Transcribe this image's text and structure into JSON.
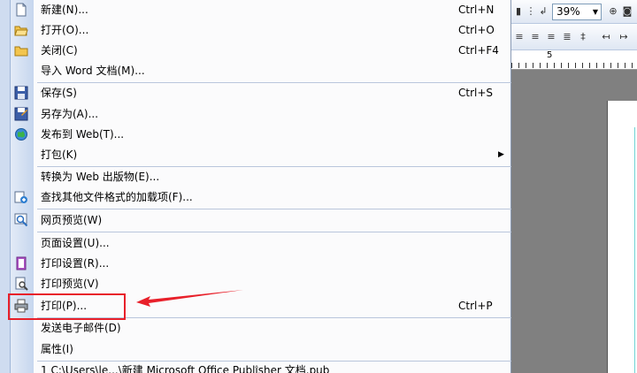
{
  "menu": {
    "items": [
      {
        "label": "新建(N)...",
        "shortcut": "Ctrl+N",
        "icon": "new-document-icon"
      },
      {
        "label": "打开(O)...",
        "shortcut": "Ctrl+O",
        "icon": "open-folder-icon"
      },
      {
        "label": "关闭(C)",
        "shortcut": "Ctrl+F4",
        "icon": "close-folder-icon"
      },
      {
        "label": "导入 Word 文档(M)...",
        "shortcut": ""
      },
      {
        "label": "保存(S)",
        "shortcut": "Ctrl+S",
        "icon": "save-icon"
      },
      {
        "label": "另存为(A)...",
        "shortcut": "",
        "icon": "save-as-icon"
      },
      {
        "label": "发布到 Web(T)...",
        "shortcut": "",
        "icon": "globe-icon"
      },
      {
        "label": "打包(K)",
        "shortcut": "",
        "has_submenu": true
      },
      {
        "label": "转换为 Web 出版物(E)...",
        "shortcut": ""
      },
      {
        "label": "查找其他文件格式的加载项(F)...",
        "shortcut": "",
        "icon": "find-addins-icon"
      },
      {
        "label": "网页预览(W)",
        "shortcut": "",
        "icon": "web-preview-icon"
      },
      {
        "label": "页面设置(U)...",
        "shortcut": ""
      },
      {
        "label": "打印设置(R)...",
        "shortcut": "",
        "icon": "print-setup-icon"
      },
      {
        "label": "打印预览(V)",
        "shortcut": "",
        "icon": "print-preview-icon"
      },
      {
        "label": "打印(P)...",
        "shortcut": "Ctrl+P",
        "icon": "printer-icon"
      },
      {
        "label": "发送电子邮件(D)",
        "shortcut": ""
      },
      {
        "label": "属性(I)",
        "shortcut": ""
      },
      {
        "label": "1 C:\\Users\\le...\\新建 Microsoft Office Publisher 文档.pub",
        "shortcut": ""
      }
    ]
  },
  "toolbar": {
    "zoom_value": "39%",
    "ruler_mark": "5"
  },
  "colors": {
    "highlight": "#e8202a",
    "menu_gutter": "#c6d6ee"
  }
}
